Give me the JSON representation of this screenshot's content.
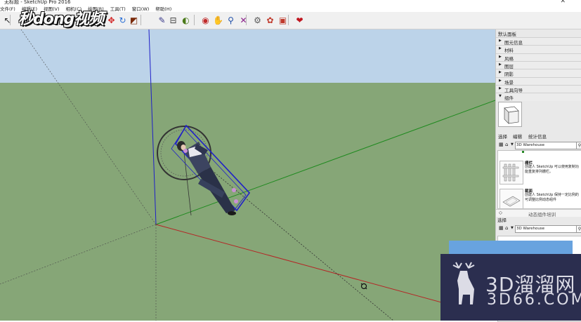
{
  "window": {
    "title": "无标题 - SketchUp Pro 2016",
    "close_glyph": "✕"
  },
  "menu": {
    "items": [
      "文件(F)",
      "编辑(E)",
      "视图(V)",
      "相机(C)",
      "绘图(R)",
      "工具(T)",
      "窗口(W)",
      "帮助(H)"
    ]
  },
  "logo": {
    "text": "秒dong视频"
  },
  "toolbar": {
    "tools": [
      {
        "name": "select-arrow",
        "glyph": "↖",
        "color": "#222222"
      },
      {
        "name": "move",
        "glyph": "✥",
        "color": "#d21f1f"
      },
      {
        "name": "rotate",
        "glyph": "↻",
        "color": "#2a6fd6"
      },
      {
        "name": "scale",
        "glyph": "◩",
        "color": "#7a2a0a"
      },
      {
        "name": "tape-measure",
        "glyph": "✎",
        "color": "#3a3a8a"
      },
      {
        "name": "dimension",
        "glyph": "⊟",
        "color": "#444444"
      },
      {
        "name": "protractor",
        "glyph": "◐",
        "color": "#4a7a1a"
      },
      {
        "name": "orbit",
        "glyph": "◉",
        "color": "#c02a2a"
      },
      {
        "name": "pan",
        "glyph": "✋",
        "color": "#b08a2a"
      },
      {
        "name": "zoom",
        "glyph": "⚲",
        "color": "#1f4fa8"
      },
      {
        "name": "zoom-extents",
        "glyph": "✕",
        "color": "#8a1f8a"
      },
      {
        "name": "warehouse",
        "glyph": "⚙",
        "color": "#5a5a5a"
      },
      {
        "name": "extension",
        "glyph": "✿",
        "color": "#c0392b"
      },
      {
        "name": "components",
        "glyph": "▣",
        "color": "#c0392b"
      },
      {
        "name": "ruby",
        "glyph": "❤",
        "color": "#c0151f"
      }
    ]
  },
  "panel": {
    "title": "默认面板",
    "trays": [
      {
        "label": "图元信息",
        "state": "▶"
      },
      {
        "label": "材料",
        "state": "▶"
      },
      {
        "label": "风格",
        "state": "▶"
      },
      {
        "label": "图层",
        "state": "▶"
      },
      {
        "label": "阴影",
        "state": "▶"
      },
      {
        "label": "场景",
        "state": "▶"
      },
      {
        "label": "工具向导",
        "state": "▶"
      },
      {
        "label": "组件",
        "state": "▼"
      }
    ],
    "tabs": [
      "选择",
      "编辑",
      "统计信息"
    ],
    "search_placeholder": "3D Warehouse",
    "items": [
      {
        "name": "栅栏",
        "desc": "创建人 SketchUp 可以使用复制功能重复排列栅栏。"
      },
      {
        "name": "截面",
        "desc": "创建人 SketchUp 保持一定比例的可调整比例动态组件"
      }
    ],
    "footer": "动态组件培训",
    "select_label": "选择",
    "search_placeholder2": "3D Warehouse"
  },
  "watermark": {
    "big": "3D溜溜网",
    "small": "3D66.COM"
  },
  "colors": {
    "sky": "#bcd3e9",
    "ground": "#86a677",
    "axis_red": "#b52525",
    "axis_green": "#1f8a1f",
    "axis_blue": "#1f1fc8",
    "panel_bg": "#e9e9e9",
    "watermark_bg": "#2b2e4f",
    "ad_blue": "#68a3df"
  }
}
